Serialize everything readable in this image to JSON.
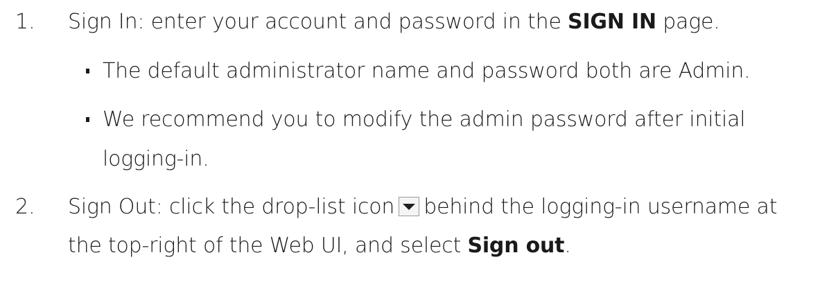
{
  "steps": [
    {
      "number": "1.",
      "text_before": "Sign In: enter your account and password in the ",
      "bold": "SIGN IN",
      "text_after": " page.",
      "bullets": [
        {
          "text": "The default administrator name and password both are Admin."
        },
        {
          "line1": "We recommend you to modify the admin password after initial",
          "line2": "logging-in."
        }
      ]
    },
    {
      "number": "2.",
      "text_before": "Sign Out: click the drop-list icon",
      "icon": "drop-list-icon",
      "text_after": "behind the logging-in username at",
      "line2_before": "the top-right of the Web UI, and select ",
      "bold": "Sign out",
      "line2_after": "."
    }
  ]
}
